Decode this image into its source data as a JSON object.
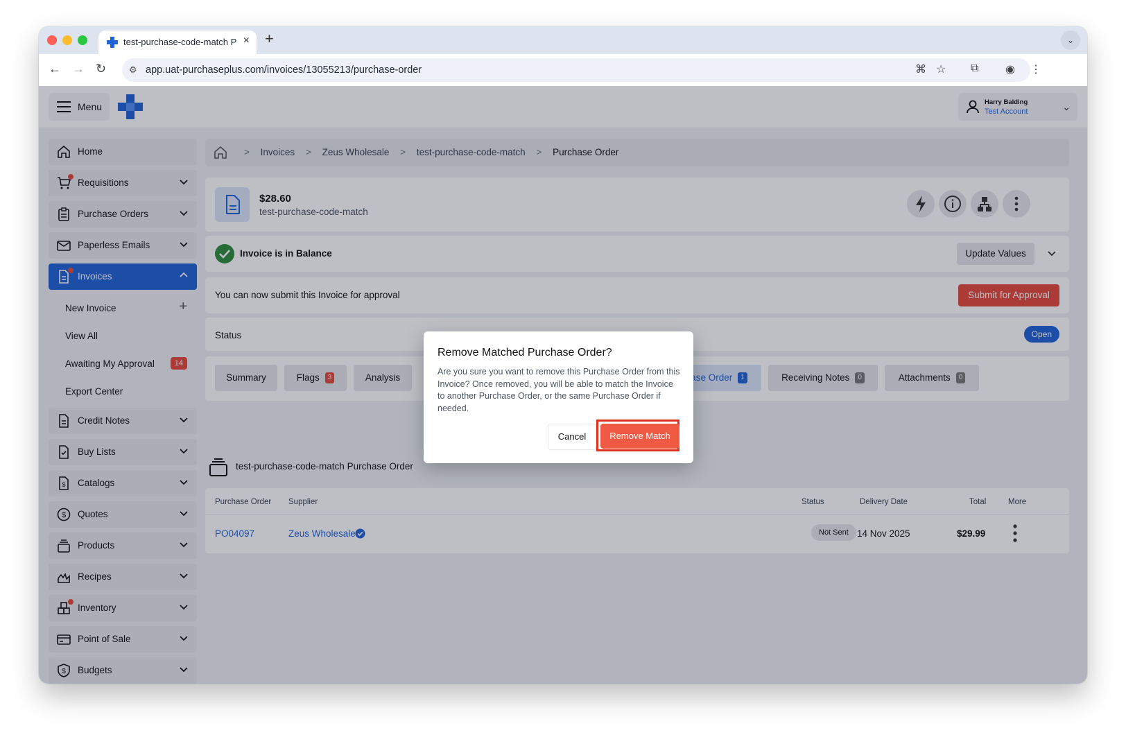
{
  "browser": {
    "tab_title": "test-purchase-code-match P",
    "url": "app.uat-purchaseplus.com/invoices/13055213/purchase-order"
  },
  "header": {
    "menu_label": "Menu",
    "user_name": "Harry Balding",
    "account": "Test Account"
  },
  "sidebar": {
    "items": [
      {
        "label": "Home",
        "icon": "home-icon"
      },
      {
        "label": "Requisitions",
        "icon": "cart-icon"
      },
      {
        "label": "Purchase Orders",
        "icon": "clipboard-icon"
      },
      {
        "label": "Paperless Emails",
        "icon": "mail-icon"
      },
      {
        "label": "Invoices",
        "icon": "invoice-icon"
      },
      {
        "label": "Credit Notes",
        "icon": "document-icon"
      },
      {
        "label": "Buy Lists",
        "icon": "checklist-icon"
      },
      {
        "label": "Catalogs",
        "icon": "dollar-doc-icon"
      },
      {
        "label": "Quotes",
        "icon": "dollar-circle-icon"
      },
      {
        "label": "Products",
        "icon": "stack-icon"
      },
      {
        "label": "Recipes",
        "icon": "flame-icon"
      },
      {
        "label": "Inventory",
        "icon": "boxes-icon"
      },
      {
        "label": "Point of Sale",
        "icon": "card-icon"
      },
      {
        "label": "Budgets",
        "icon": "shield-dollar-icon"
      }
    ],
    "invoices_sub": {
      "new_invoice": "New Invoice",
      "view_all": "View All",
      "awaiting": "Awaiting My Approval",
      "awaiting_count": "14",
      "export": "Export Center"
    }
  },
  "breadcrumb": [
    "Invoices",
    "Zeus Wholesale",
    "test-purchase-code-match",
    "Purchase Order"
  ],
  "invoice": {
    "amount": "$28.60",
    "name": "test-purchase-code-match",
    "balance_text": "Invoice is in Balance",
    "update_values": "Update Values",
    "submit_msg": "You can now submit this Invoice for approval",
    "submit_btn": "Submit for Approval",
    "status_label": "Status",
    "status_value": "Open"
  },
  "tabs": [
    {
      "label": "Summary"
    },
    {
      "label": "Flags",
      "count": "3"
    },
    {
      "label": "Analysis"
    },
    {
      "label": "chase Order",
      "count": "1"
    },
    {
      "label": "Receiving Notes",
      "count": "0"
    },
    {
      "label": "Attachments",
      "count": "0"
    }
  ],
  "po_section": {
    "title": "test-purchase-code-match Purchase Order",
    "columns": [
      "Purchase Order",
      "Supplier",
      "Status",
      "Delivery Date",
      "Total",
      "More"
    ],
    "row": {
      "po": "PO04097",
      "supplier": "Zeus Wholesale",
      "status": "Not Sent",
      "delivery": "14 Nov 2025",
      "total": "$29.99"
    }
  },
  "modal": {
    "title": "Remove Matched Purchase Order?",
    "body": "Are you sure you want to remove this Purchase Order from this Invoice? Once removed, you will be able to match the Invoice to another Purchase Order, or the same Purchase Order if needed.",
    "cancel": "Cancel",
    "confirm": "Remove Match"
  },
  "colors": {
    "primary": "#1f63d6",
    "danger": "#e5493a",
    "success": "#2e8b3a"
  }
}
